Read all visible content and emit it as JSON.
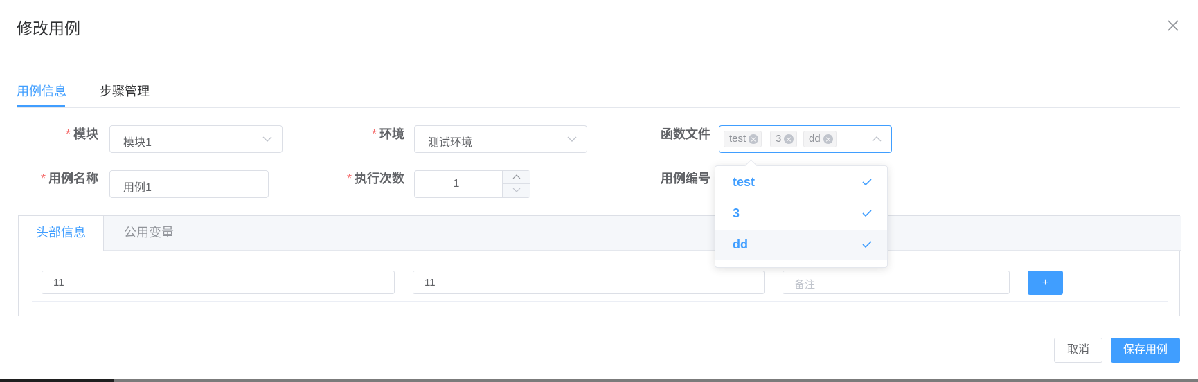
{
  "dialog": {
    "title": "修改用例"
  },
  "tabs": [
    {
      "label": "用例信息"
    },
    {
      "label": "步骤管理"
    }
  ],
  "form": {
    "module": {
      "label": "模块",
      "value": "模块1"
    },
    "env": {
      "label": "环境",
      "value": "测试环境"
    },
    "func_file": {
      "label": "函数文件",
      "tags": [
        "test",
        "3",
        "dd"
      ]
    },
    "case_name": {
      "label": "用例名称",
      "value": "用例1"
    },
    "run_count": {
      "label": "执行次数",
      "value": "1"
    },
    "case_no": {
      "label": "用例编号"
    }
  },
  "dropdown": {
    "options": [
      "test",
      "3",
      "dd"
    ]
  },
  "card": {
    "tabs": [
      "头部信息",
      "公用变量"
    ],
    "row": {
      "key": "11",
      "value": "11",
      "note_placeholder": "备注"
    },
    "add_label": "+"
  },
  "footer": {
    "cancel": "取消",
    "save": "保存用例"
  },
  "colors": {
    "primary": "#409eff",
    "required": "#f56c6c"
  }
}
